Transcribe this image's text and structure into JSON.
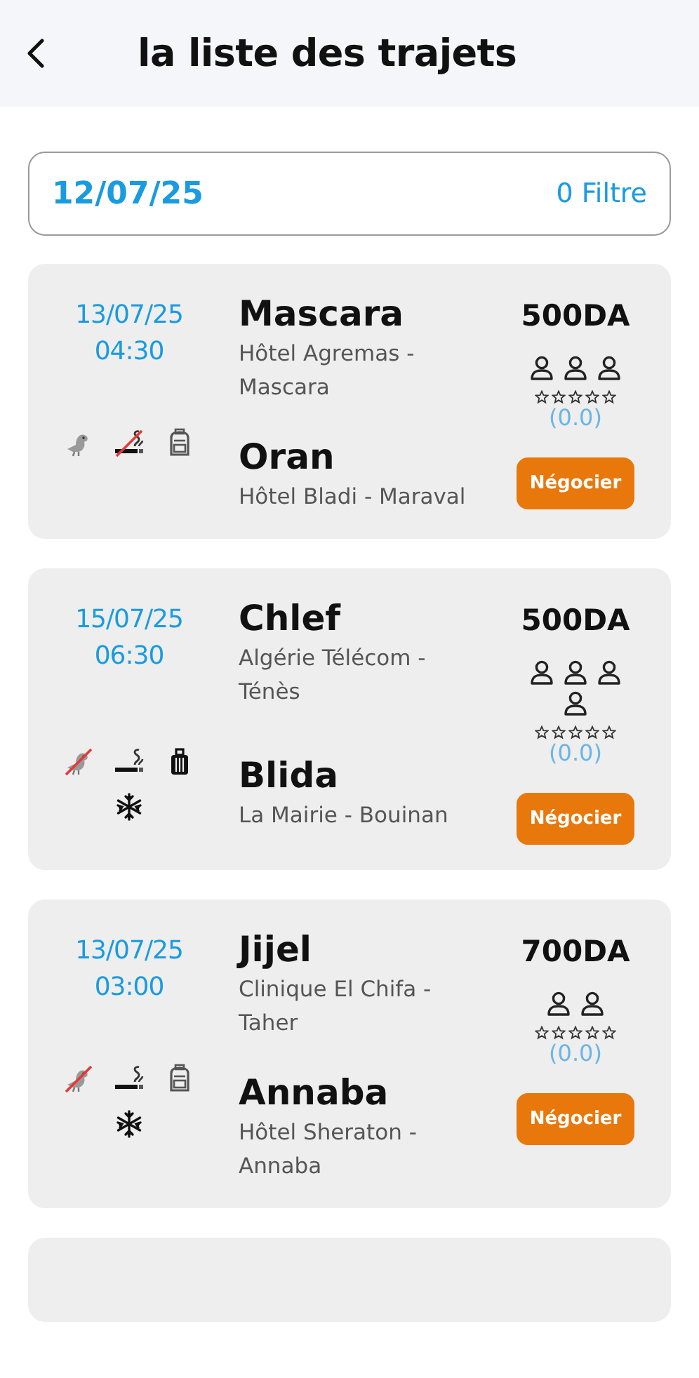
{
  "header": {
    "title": "la liste des trajets"
  },
  "filter_bar": {
    "date": "12/07/25",
    "filter": "0 Filtre"
  },
  "trips": [
    {
      "date": "13/07/25",
      "time": "04:30",
      "from": {
        "city": "Mascara",
        "place": "Hôtel Agremas - Mascara"
      },
      "to": {
        "city": "Oran",
        "place": "Hôtel Bladi - Maraval"
      },
      "price": "500DA",
      "seats": [
        {
          "kind": "seat"
        },
        {
          "kind": "seat"
        },
        {
          "kind": "seat"
        }
      ],
      "stars": 0,
      "rating": "(0.0)",
      "button": "Négocier",
      "amenities": [
        {
          "kind": "animal",
          "allowed": true
        },
        {
          "kind": "smoking",
          "allowed": false
        },
        {
          "kind": "backpack",
          "allowed": true
        }
      ]
    },
    {
      "date": "15/07/25",
      "time": "06:30",
      "from": {
        "city": "Chlef",
        "place": "Algérie Télécom - Ténès"
      },
      "to": {
        "city": "Blida",
        "place": "La Mairie - Bouinan"
      },
      "price": "500DA",
      "seats": [
        {
          "kind": "seat"
        },
        {
          "kind": "seat"
        },
        {
          "kind": "seat"
        },
        {
          "kind": "seat"
        }
      ],
      "stars": 0,
      "rating": "(0.0)",
      "button": "Négocier",
      "amenities": [
        {
          "kind": "animal",
          "allowed": false
        },
        {
          "kind": "smoking",
          "allowed": true
        },
        {
          "kind": "suitcase",
          "allowed": true
        },
        {
          "kind": "air_conditioning",
          "allowed": true
        }
      ]
    },
    {
      "date": "13/07/25",
      "time": "03:00",
      "from": {
        "city": "Jijel",
        "place": "Clinique El Chifa - Taher"
      },
      "to": {
        "city": "Annaba",
        "place": "Hôtel Sheraton - Annaba"
      },
      "price": "700DA",
      "seats": [
        {
          "kind": "seat"
        },
        {
          "kind": "seat"
        }
      ],
      "stars": 0,
      "rating": "(0.0)",
      "button": "Négocier",
      "amenities": [
        {
          "kind": "animal",
          "allowed": false
        },
        {
          "kind": "smoking",
          "allowed": true
        },
        {
          "kind": "backpack",
          "allowed": true
        },
        {
          "kind": "air_conditioning",
          "allowed": true
        }
      ]
    }
  ],
  "next_card_peek": true
}
